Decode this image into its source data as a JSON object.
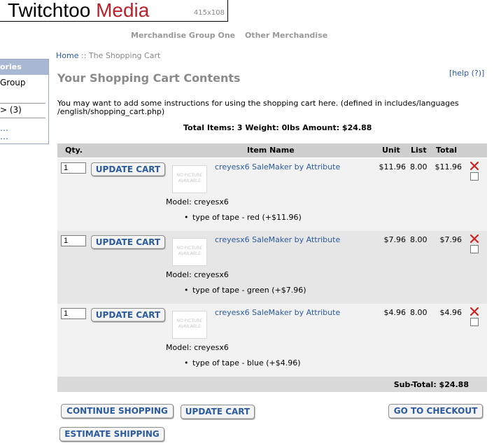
{
  "logo": {
    "text_a": "Twitchtoo",
    "text_b": "Media",
    "dim": "415x108",
    "brand_color": "#b8222a"
  },
  "topnav": {
    "items": [
      "Merchandise Group One",
      "Other Merchandise"
    ]
  },
  "sidebar": {
    "header": "ories",
    "items": [
      "Group",
      "> (3)",
      "…",
      "…"
    ]
  },
  "breadcrumb": {
    "home": "Home",
    "sep": "::",
    "current": "The Shopping Cart"
  },
  "page_title": "Your Shopping Cart Contents",
  "help": "[help (?)]",
  "instructions": "You may want to add some instructions for using the shopping cart here. (defined in includes/languages /english/shopping_cart.php)",
  "totals": "Total Items: 3  Weight: 0lbs  Amount: $24.88",
  "table": {
    "headers": {
      "qty": "Qty.",
      "name": "Item Name",
      "unit": "Unit",
      "list": "List",
      "total": "Total"
    },
    "rows": [
      {
        "qty": "1",
        "button": "UPDATE CART",
        "nopic": "NO PICTURE AVAILABLE",
        "name": "creyesx6 SaleMaker by Attribute",
        "model": "Model: creyesx6",
        "attr": "type of tape - red (+$11.96)",
        "unit": "$11.96",
        "list": "8.00",
        "total": "$11.96"
      },
      {
        "qty": "1",
        "button": "UPDATE CART",
        "nopic": "NO PICTURE AVAILABLE",
        "name": "creyesx6 SaleMaker by Attribute",
        "model": "Model: creyesx6",
        "attr": "type of tape - green (+$7.96)",
        "unit": "$7.96",
        "list": "8.00",
        "total": "$7.96"
      },
      {
        "qty": "1",
        "button": "UPDATE CART",
        "nopic": "NO PICTURE AVAILABLE",
        "name": "creyesx6 SaleMaker by Attribute",
        "model": "Model: creyesx6",
        "attr": "type of tape - blue (+$4.96)",
        "unit": "$4.96",
        "list": "8.00",
        "total": "$4.96"
      }
    ],
    "subtotal": "Sub-Total: $24.88"
  },
  "buttons": {
    "continue": "CONTINUE SHOPPING",
    "update": "UPDATE CART",
    "checkout": "GO TO CHECKOUT",
    "estimate": "ESTIMATE SHIPPING"
  },
  "colors": {
    "link": "#2a5aa0",
    "delete": "#cc2222"
  }
}
